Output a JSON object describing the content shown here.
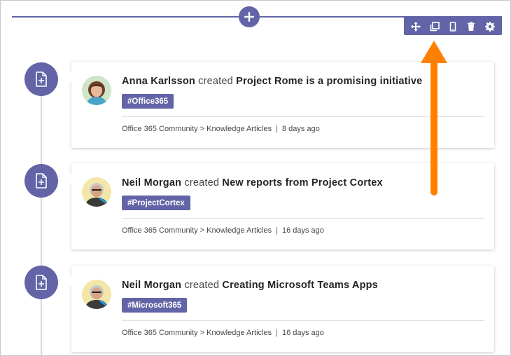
{
  "toolbar": {
    "icons": [
      "move-icon",
      "duplicate-icon",
      "mobile-icon",
      "delete-icon",
      "settings-icon"
    ]
  },
  "colors": {
    "accent": "#6264a7",
    "arrow": "#ff8000"
  },
  "feed": [
    {
      "author": "Anna Karlsson",
      "verb": "created",
      "title": "Project Rome is a promising initiative",
      "tag": "#Office365",
      "location": "Office 365 Community > Knowledge Articles",
      "separator": "|",
      "time": "8 days ago"
    },
    {
      "author": "Neil Morgan",
      "verb": "created",
      "title": "New reports from Project Cortex",
      "tag": "#ProjectCortex",
      "location": "Office 365 Community > Knowledge Articles",
      "separator": "|",
      "time": "16 days ago"
    },
    {
      "author": "Neil Morgan",
      "verb": "created",
      "title": "Creating Microsoft Teams Apps",
      "tag": "#Microsoft365",
      "location": "Office 365 Community > Knowledge Articles",
      "separator": "|",
      "time": "16 days ago"
    }
  ]
}
